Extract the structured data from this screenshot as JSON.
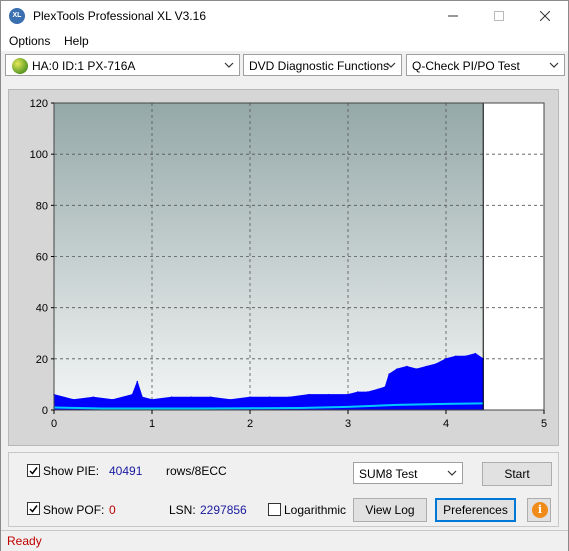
{
  "window": {
    "title": "PlexTools Professional XL V3.16",
    "app_icon": "XL"
  },
  "menu": [
    {
      "label": "Options"
    },
    {
      "label": "Help"
    }
  ],
  "toolbar": {
    "drive": "HA:0 ID:1  PX-716A",
    "function": "DVD Diagnostic Functions",
    "test": "Q-Check PI/PO Test"
  },
  "chart_data": {
    "type": "area",
    "xlim": [
      0,
      5
    ],
    "ylim": [
      0,
      120
    ],
    "x_ticks": [
      "0",
      "1",
      "2",
      "3",
      "4",
      "5"
    ],
    "y_ticks": [
      "0",
      "20",
      "40",
      "60",
      "80",
      "100",
      "120"
    ],
    "grid": true,
    "end_marker_x": 4.38,
    "series": [
      {
        "color": "#0000ff",
        "x": [
          0,
          0.2,
          0.4,
          0.6,
          0.8,
          0.85,
          0.9,
          1.0,
          1.2,
          1.4,
          1.6,
          1.8,
          2.0,
          2.2,
          2.4,
          2.6,
          2.8,
          3.0,
          3.1,
          3.2,
          3.3,
          3.38,
          3.42,
          3.5,
          3.6,
          3.7,
          3.8,
          3.9,
          4.0,
          4.1,
          4.2,
          4.3,
          4.38
        ],
        "values": [
          6,
          4,
          5,
          4,
          6,
          11,
          5,
          4,
          5,
          5,
          5,
          4,
          5,
          5,
          5,
          6,
          6,
          6,
          7,
          7,
          8,
          9,
          14,
          16,
          17,
          16,
          17,
          18,
          20,
          21,
          21,
          22,
          20
        ]
      },
      {
        "color": "#00c8ff",
        "x": [
          0,
          0.5,
          1.0,
          1.5,
          2.0,
          2.5,
          3.0,
          3.5,
          4.0,
          4.38
        ],
        "values": [
          1,
          0.6,
          0.6,
          0.6,
          0.7,
          0.8,
          1.2,
          2.0,
          2.4,
          2.6
        ]
      }
    ]
  },
  "bottom": {
    "show_pie_label": "Show PIE:",
    "pie_value": "40491",
    "pie_unit": "rows/8ECC",
    "show_pof_label": "Show POF:",
    "pof_value": "0",
    "lsn_label": "LSN:",
    "lsn_value": "2297856",
    "logarithmic_label": "Logarithmic",
    "test_mode": "SUM8 Test",
    "start_label": "Start",
    "view_log_label": "View Log",
    "preferences_label": "Preferences",
    "info_glyph": "i"
  },
  "status": "Ready"
}
